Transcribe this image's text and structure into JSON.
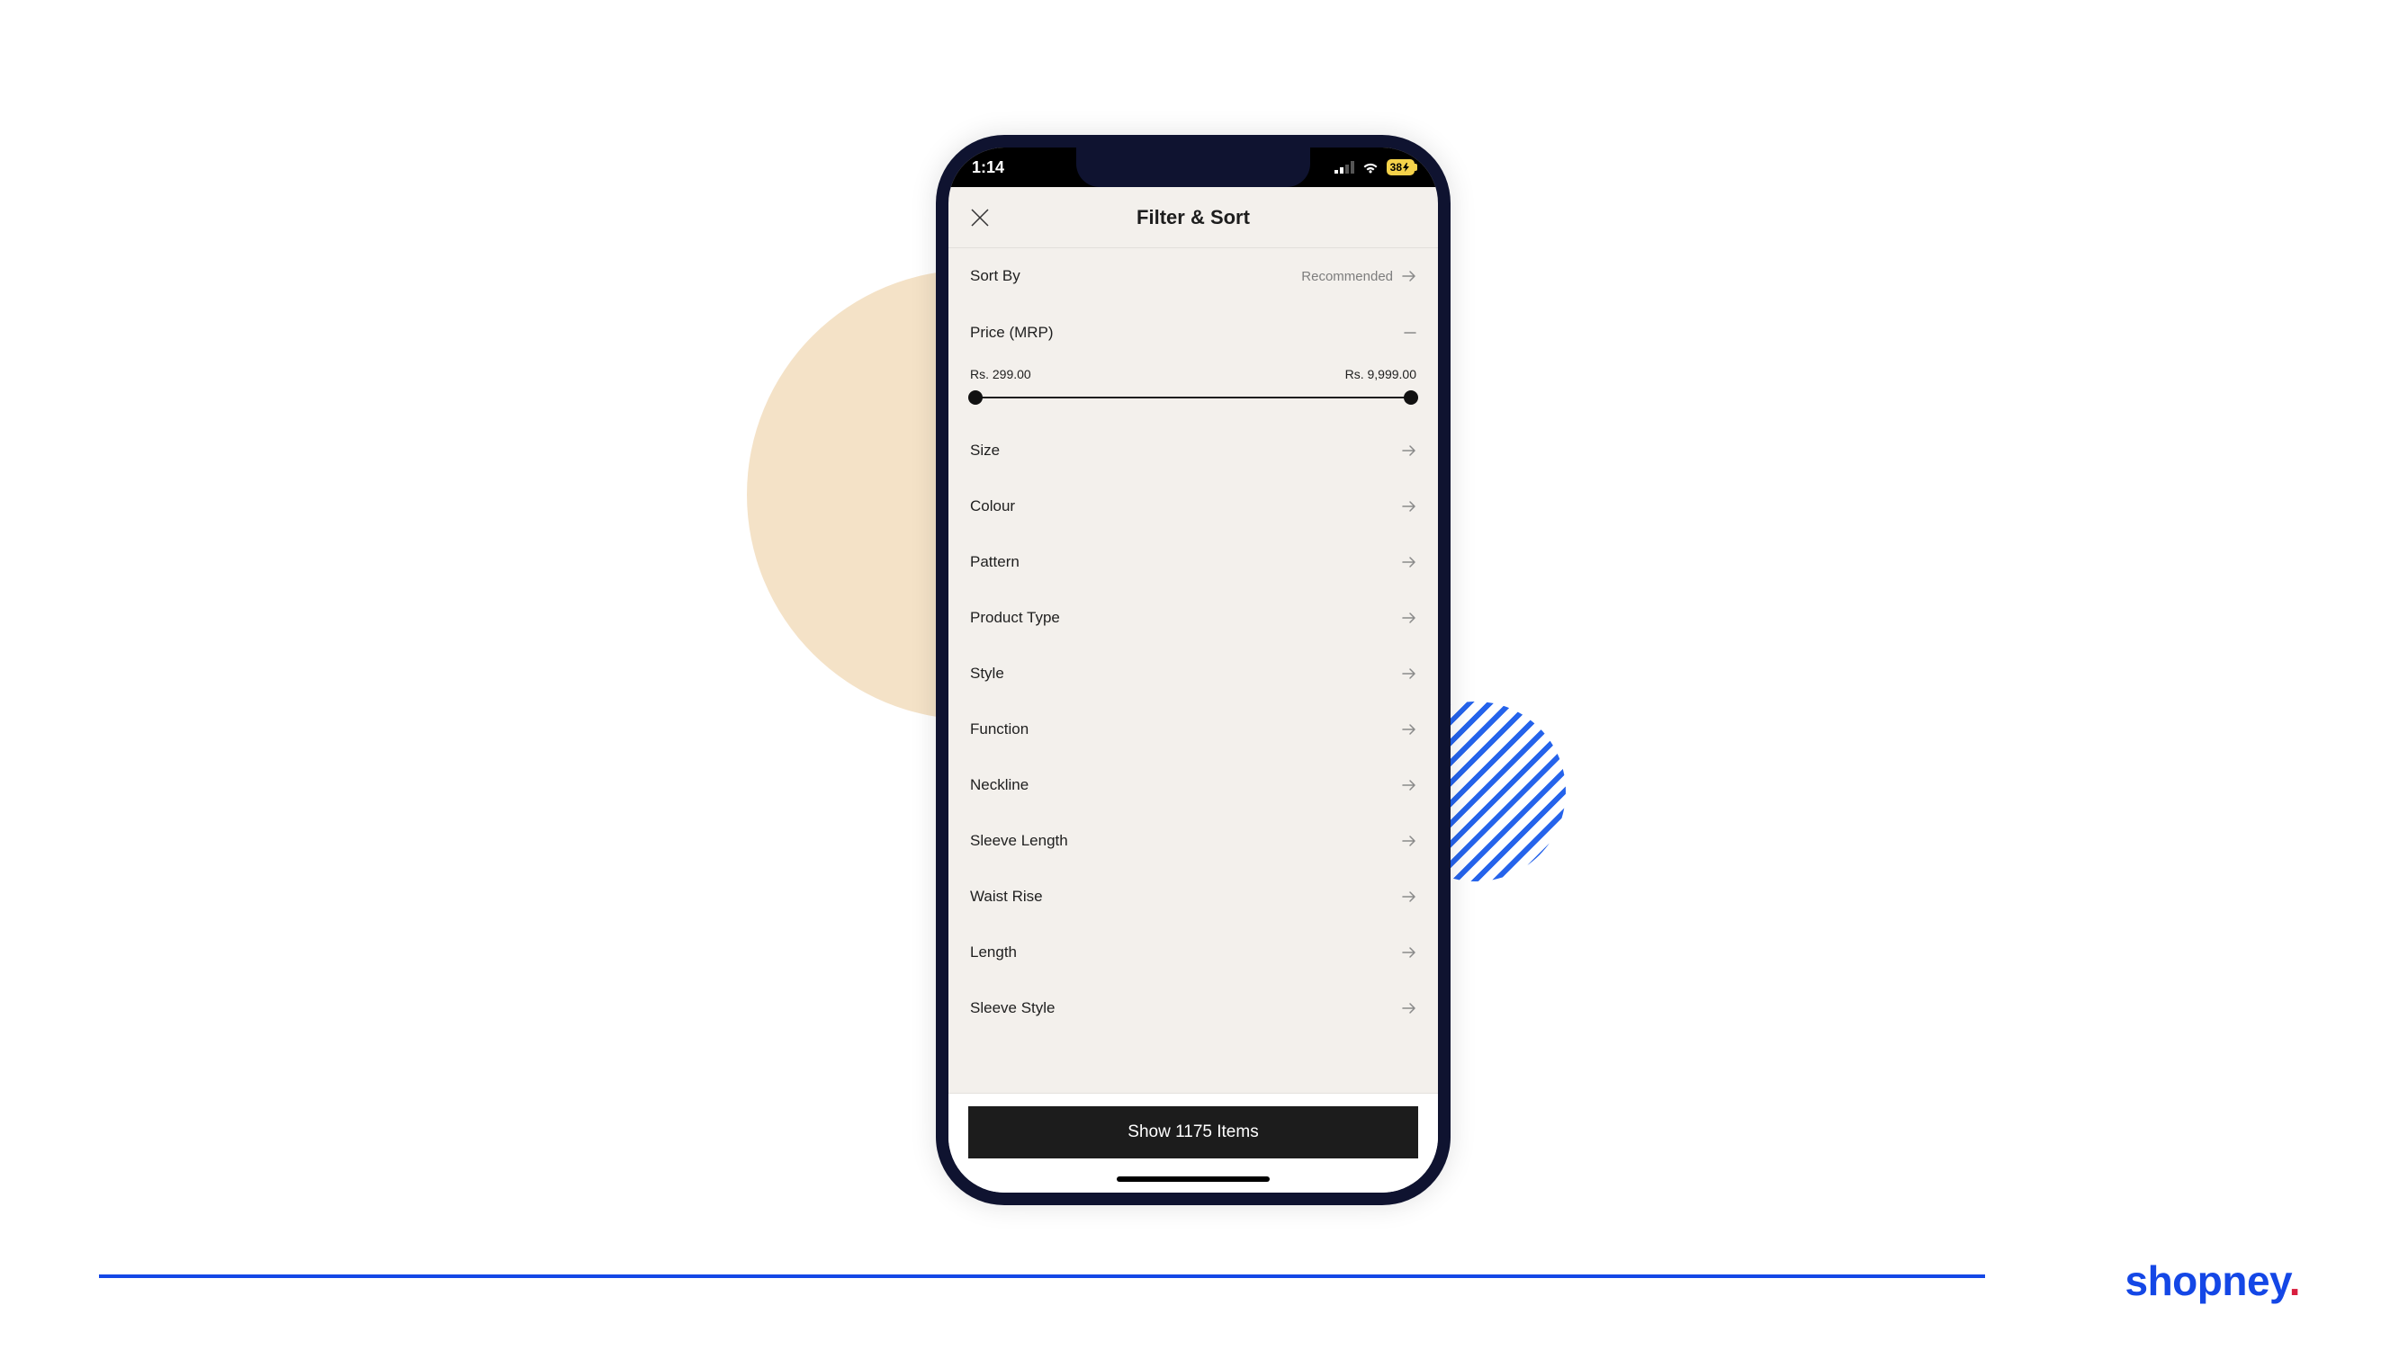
{
  "status": {
    "time": "1:14",
    "battery": "38"
  },
  "header": {
    "title": "Filter & Sort"
  },
  "sort": {
    "label": "Sort By",
    "value": "Recommended"
  },
  "price": {
    "label": "Price (MRP)",
    "min": "Rs. 299.00",
    "max": "Rs. 9,999.00"
  },
  "filters": [
    {
      "label": "Size"
    },
    {
      "label": "Colour"
    },
    {
      "label": "Pattern"
    },
    {
      "label": "Product Type"
    },
    {
      "label": "Style"
    },
    {
      "label": "Function"
    },
    {
      "label": "Neckline"
    },
    {
      "label": "Sleeve Length"
    },
    {
      "label": "Waist Rise"
    },
    {
      "label": "Length"
    },
    {
      "label": "Sleeve Style"
    }
  ],
  "footer": {
    "button": "Show 1175 Items"
  },
  "brand": {
    "name": "shopney"
  }
}
